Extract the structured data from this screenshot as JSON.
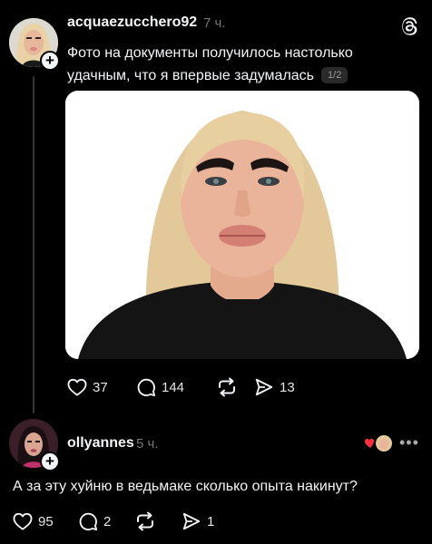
{
  "post": {
    "username": "acquaezucchero92",
    "time": "7 ч.",
    "text": "Фото на документы получилось настолько удачным, что я впервые задумалась",
    "page_counter": "1/2",
    "likes": "37",
    "comments": "144",
    "shares": "13"
  },
  "reply": {
    "username": "ollyannes",
    "time": "5 ч.",
    "text": "А за эту хуйню в ведьмаке сколько опыта накинут?",
    "likes": "95",
    "comments": "2",
    "shares": "1"
  },
  "colors": {
    "background": "#000000",
    "text": "#f3f5f7",
    "muted": "#777777",
    "like_heart": "#ff3040"
  },
  "icons": [
    "threads-logo-icon",
    "heart-icon",
    "comment-icon",
    "repost-icon",
    "share-icon",
    "plus-icon",
    "more-icon"
  ]
}
